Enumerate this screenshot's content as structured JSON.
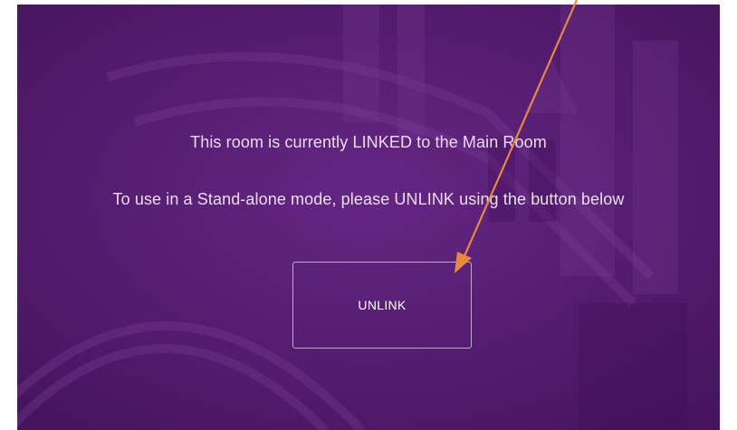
{
  "screen": {
    "line_linked": "This room is currently LINKED to the Main Room",
    "line_instructions": "To use in a Stand-alone mode, please UNLINK using the button below"
  },
  "unlink_button": {
    "label": "UNLINK"
  },
  "colors": {
    "background_purple": "#5c1f7a",
    "annotation_arrow": "#e8893a",
    "text": "#e9def0"
  },
  "icons": {
    "annotation": "orange-arrow-icon"
  }
}
